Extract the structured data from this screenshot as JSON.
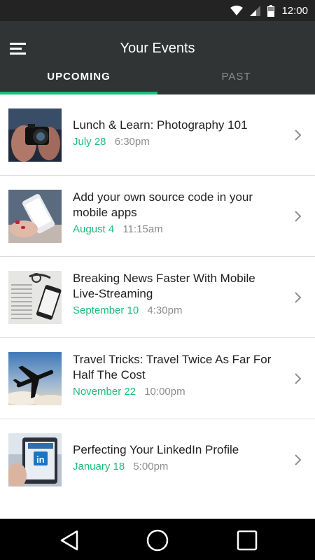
{
  "status_bar": {
    "time": "12:00",
    "icons": [
      "wifi-icon",
      "signal-icon",
      "battery-icon"
    ]
  },
  "app_bar": {
    "title": "Your Events",
    "menu_icon": "hamburger-menu-icon"
  },
  "tabs": [
    {
      "label": "UPCOMING",
      "active": true
    },
    {
      "label": "PAST",
      "active": false
    }
  ],
  "colors": {
    "accent": "#1dbc7c",
    "appbar": "#313434",
    "statusbar": "#232323"
  },
  "events": [
    {
      "title": "Lunch & Learn: Photography 101",
      "date": "July 28",
      "time": "6:30pm",
      "image": "camera-photo"
    },
    {
      "title": "Add your own source code in your mobile apps",
      "date": "August 4",
      "time": "11:15am",
      "image": "phone-in-hand-photo"
    },
    {
      "title": "Breaking News Faster With Mobile Live-Streaming",
      "date": "September 10",
      "time": "4:30pm",
      "image": "newspaper-phone-photo"
    },
    {
      "title": "Travel Tricks: Travel Twice As Far For Half The Cost",
      "date": "November 22",
      "time": "10:00pm",
      "image": "airplane-sky-photo"
    },
    {
      "title": "Perfecting Your LinkedIn Profile",
      "date": "January 18",
      "time": "5:00pm",
      "image": "linkedin-phone-photo"
    }
  ],
  "nav_bar": {
    "buttons": [
      "back-icon",
      "home-icon",
      "recents-icon"
    ]
  }
}
